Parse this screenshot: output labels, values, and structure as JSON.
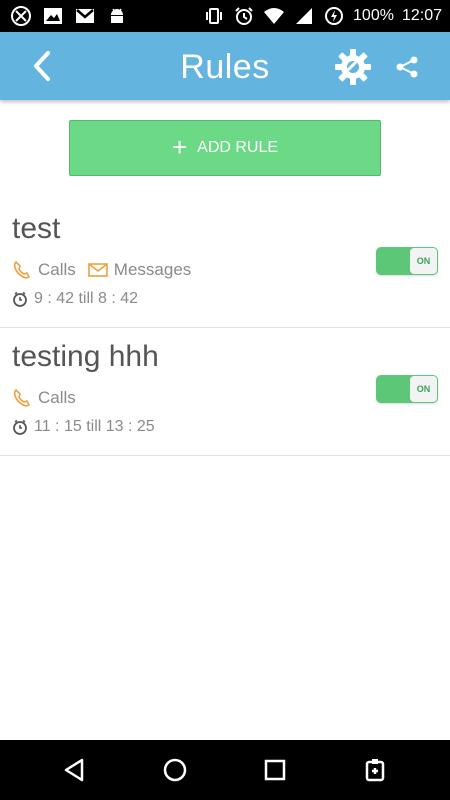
{
  "status_bar": {
    "battery": "100%",
    "time": "12:07"
  },
  "app_bar": {
    "title": "Rules"
  },
  "add_rule": {
    "label": "ADD RULE"
  },
  "rules": [
    {
      "name": "test",
      "categories": [
        "Calls",
        "Messages"
      ],
      "time": "9 : 42 till 8 : 42",
      "toggle": "ON"
    },
    {
      "name": "testing hhh",
      "categories": [
        "Calls"
      ],
      "time": "11 : 15 till 13 : 25",
      "toggle": "ON"
    }
  ],
  "icons": {
    "status": [
      "vpn-icon",
      "image-icon",
      "gmail-icon",
      "android-icon",
      "vibrate-icon",
      "alarm-icon",
      "wifi-icon",
      "data-saver-icon"
    ],
    "nav": [
      "back-triangle-icon",
      "home-circle-icon",
      "recents-square-icon",
      "task-icon"
    ]
  },
  "colors": {
    "app_bar": "#63b5e0",
    "add_rule": "#6bd985",
    "toggle_on": "#5cc777",
    "category_icon": "#f0a040"
  }
}
